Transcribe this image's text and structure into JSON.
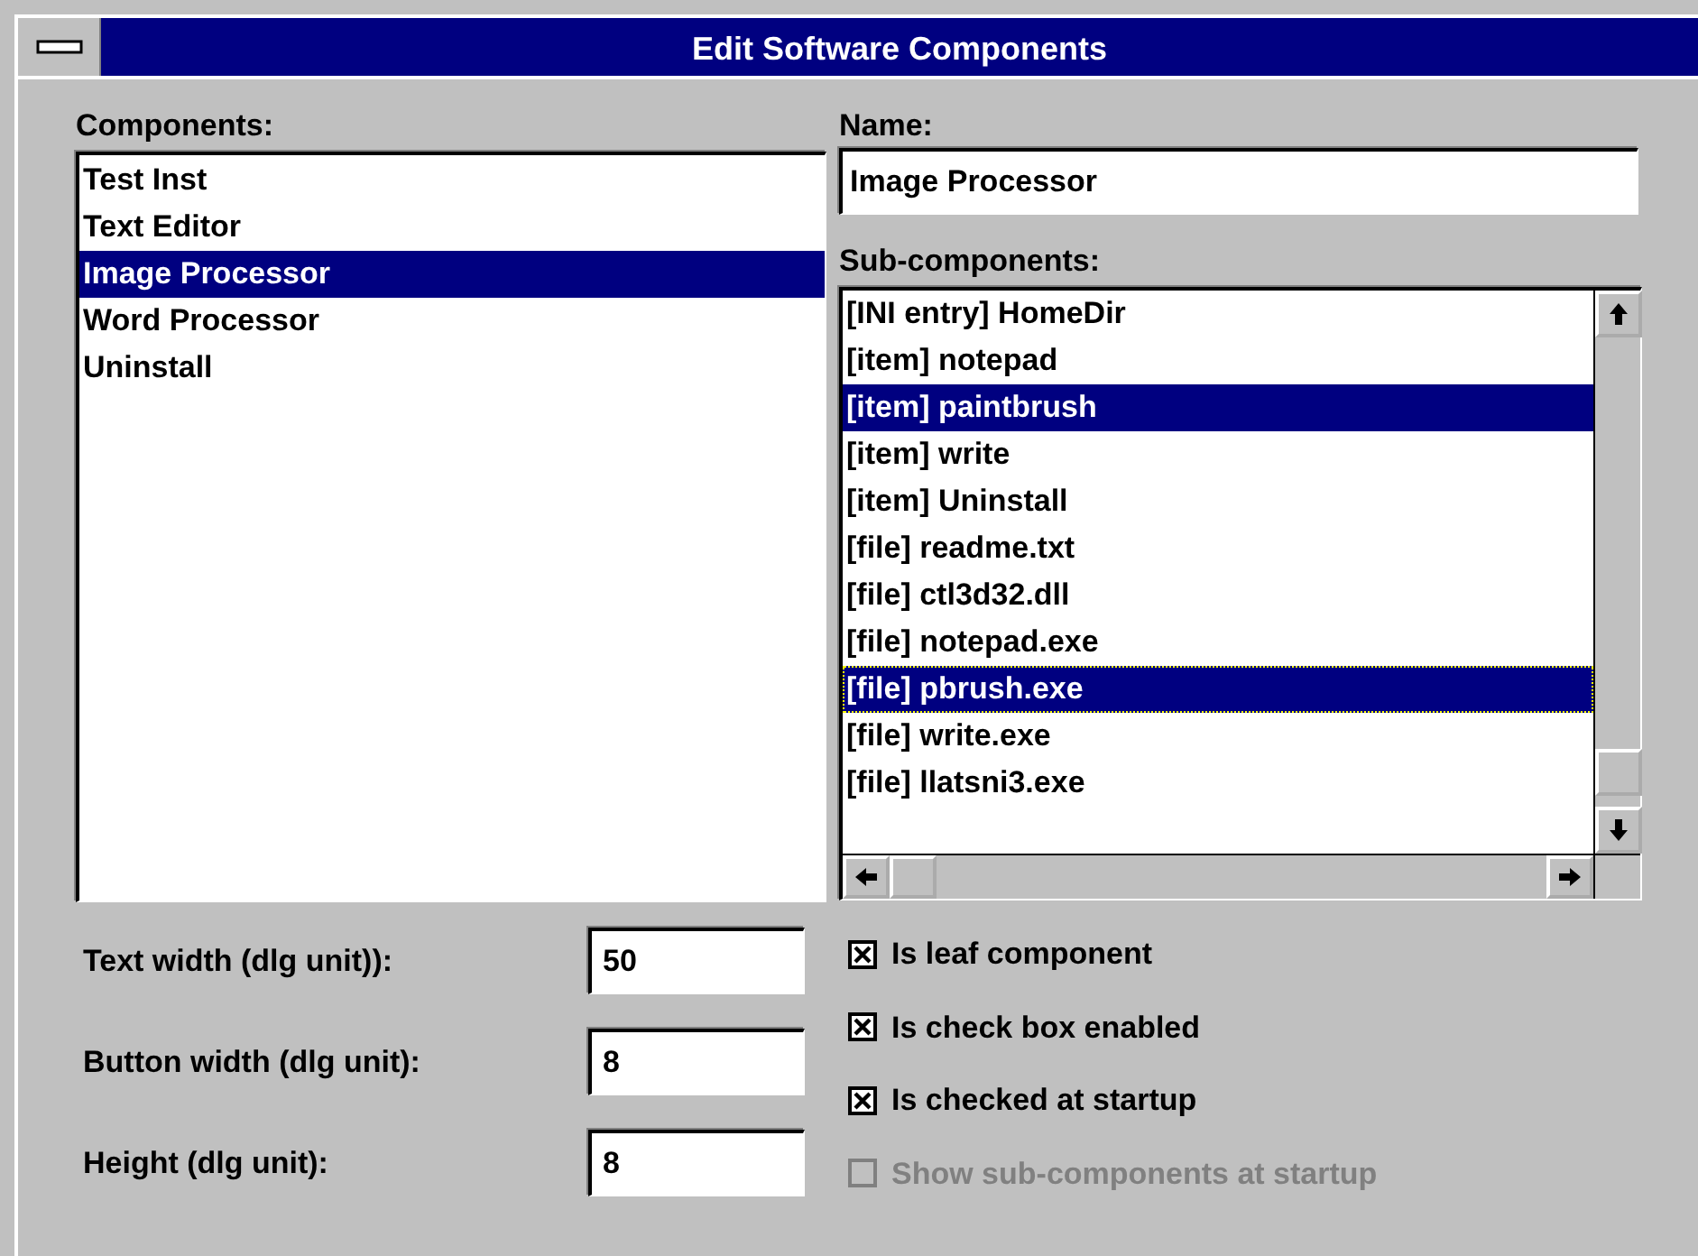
{
  "window": {
    "title": "Edit Software Components"
  },
  "components": {
    "label": "Components:",
    "items": [
      {
        "text": "Test Inst",
        "selected": false
      },
      {
        "text": "Text Editor",
        "selected": false
      },
      {
        "text": "Image Processor",
        "selected": true
      },
      {
        "text": "Word Processor",
        "selected": false
      },
      {
        "text": "Uninstall",
        "selected": false
      }
    ]
  },
  "name": {
    "label": "Name:",
    "value": "Image Processor"
  },
  "sub_components": {
    "label": "Sub-components:",
    "items": [
      {
        "text": "[INI entry] HomeDir",
        "selected": false,
        "focused": false
      },
      {
        "text": "[item] notepad",
        "selected": false,
        "focused": false
      },
      {
        "text": "[item] paintbrush",
        "selected": true,
        "focused": false
      },
      {
        "text": "[item] write",
        "selected": false,
        "focused": false
      },
      {
        "text": "[item] Uninstall",
        "selected": false,
        "focused": false
      },
      {
        "text": "[file] readme.txt",
        "selected": false,
        "focused": false
      },
      {
        "text": "[file] ctl3d32.dll",
        "selected": false,
        "focused": false
      },
      {
        "text": "[file] notepad.exe",
        "selected": false,
        "focused": false
      },
      {
        "text": "[file] pbrush.exe",
        "selected": true,
        "focused": true
      },
      {
        "text": "[file] write.exe",
        "selected": false,
        "focused": false
      },
      {
        "text": "[file] llatsni3.exe",
        "selected": false,
        "focused": false
      }
    ]
  },
  "fields": [
    {
      "label": "Text width (dlg unit)):",
      "value": "50"
    },
    {
      "label": "Button width (dlg unit):",
      "value": "8"
    },
    {
      "label": "Height (dlg unit):",
      "value": "8"
    }
  ],
  "options": [
    {
      "label": "Is leaf component",
      "checked": true,
      "disabled": false
    },
    {
      "label": "Is check box enabled",
      "checked": true,
      "disabled": false
    },
    {
      "label": "Is checked at startup",
      "checked": true,
      "disabled": false
    },
    {
      "label": "Show sub-components at startup",
      "checked": false,
      "disabled": true
    }
  ]
}
